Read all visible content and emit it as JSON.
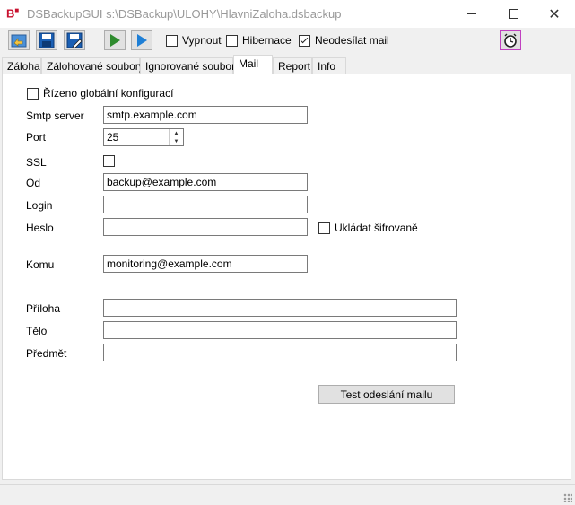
{
  "window": {
    "logo_text": "B",
    "title": "DSBackupGUI s:\\DSBackup\\ULOHY\\HlavniZaloha.dsbackup",
    "minimize_icon": "minimize-icon",
    "maximize_icon": "maximize-icon",
    "close_icon": "close-icon",
    "close_glyph": "✕"
  },
  "toolbar": {
    "buttons": [
      {
        "icon": "open-folder-icon"
      },
      {
        "icon": "save-icon"
      },
      {
        "icon": "save-as-icon"
      },
      {
        "icon": "run-icon",
        "color": "#2e8b2e"
      },
      {
        "icon": "run-step-icon",
        "color": "#1e7fd6"
      }
    ],
    "vypnout_label": "Vypnout",
    "vypnout_checked": false,
    "hibernace_label": "Hibernace",
    "hibernace_checked": false,
    "neodesilat_label": "Neodesílat mail",
    "neodesilat_checked": true,
    "schedule_icon": "clock-icon",
    "schedule_color": "#c040c0"
  },
  "tabs": [
    {
      "label": "Záloha"
    },
    {
      "label": "Zálohované soubory"
    },
    {
      "label": "Ignorované soubory"
    },
    {
      "label": "Mail",
      "active": true
    },
    {
      "label": "Report"
    },
    {
      "label": "Info"
    }
  ],
  "mail": {
    "global_config_label": "Řízeno globální konfigurací",
    "global_config_checked": false,
    "smtp_label": "Smtp server",
    "smtp_value": "smtp.example.com",
    "port_label": "Port",
    "port_value": "25",
    "ssl_label": "SSL",
    "ssl_checked": false,
    "from_label": "Od",
    "from_value": "backup@example.com",
    "login_label": "Login",
    "login_value": "",
    "password_label": "Heslo",
    "password_value": "",
    "encrypt_label": "Ukládat šifrovaně",
    "encrypt_checked": false,
    "to_label": "Komu",
    "to_value": "monitoring@example.com",
    "attachment_label": "Příloha",
    "attachment_value": "",
    "body_label": "Tělo",
    "body_value": "",
    "subject_label": "Předmět",
    "subject_value": "",
    "test_button_label": "Test odeslání mailu"
  }
}
